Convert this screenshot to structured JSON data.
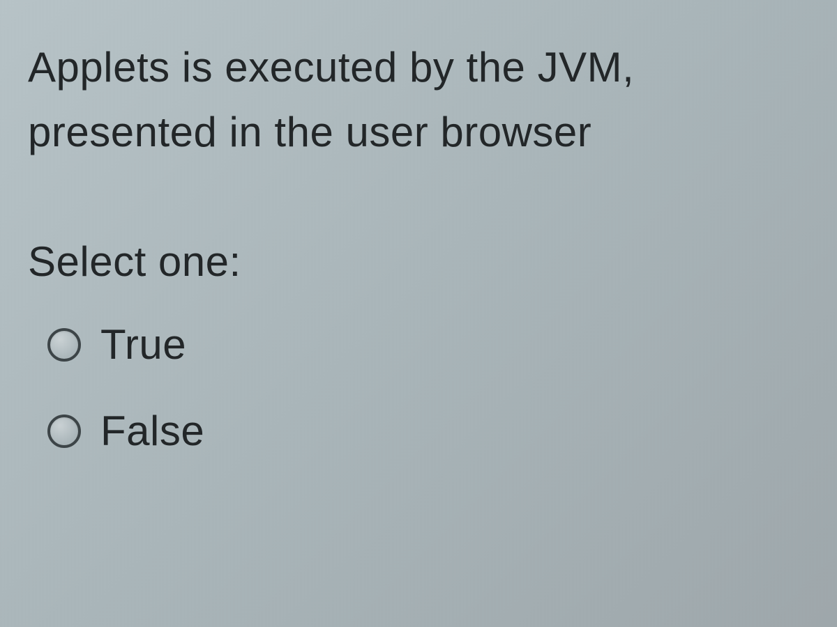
{
  "question": {
    "text": "Applets is executed by the JVM, presented in the user browser",
    "prompt": "Select one:",
    "options": [
      {
        "label": "True"
      },
      {
        "label": "False"
      }
    ]
  }
}
